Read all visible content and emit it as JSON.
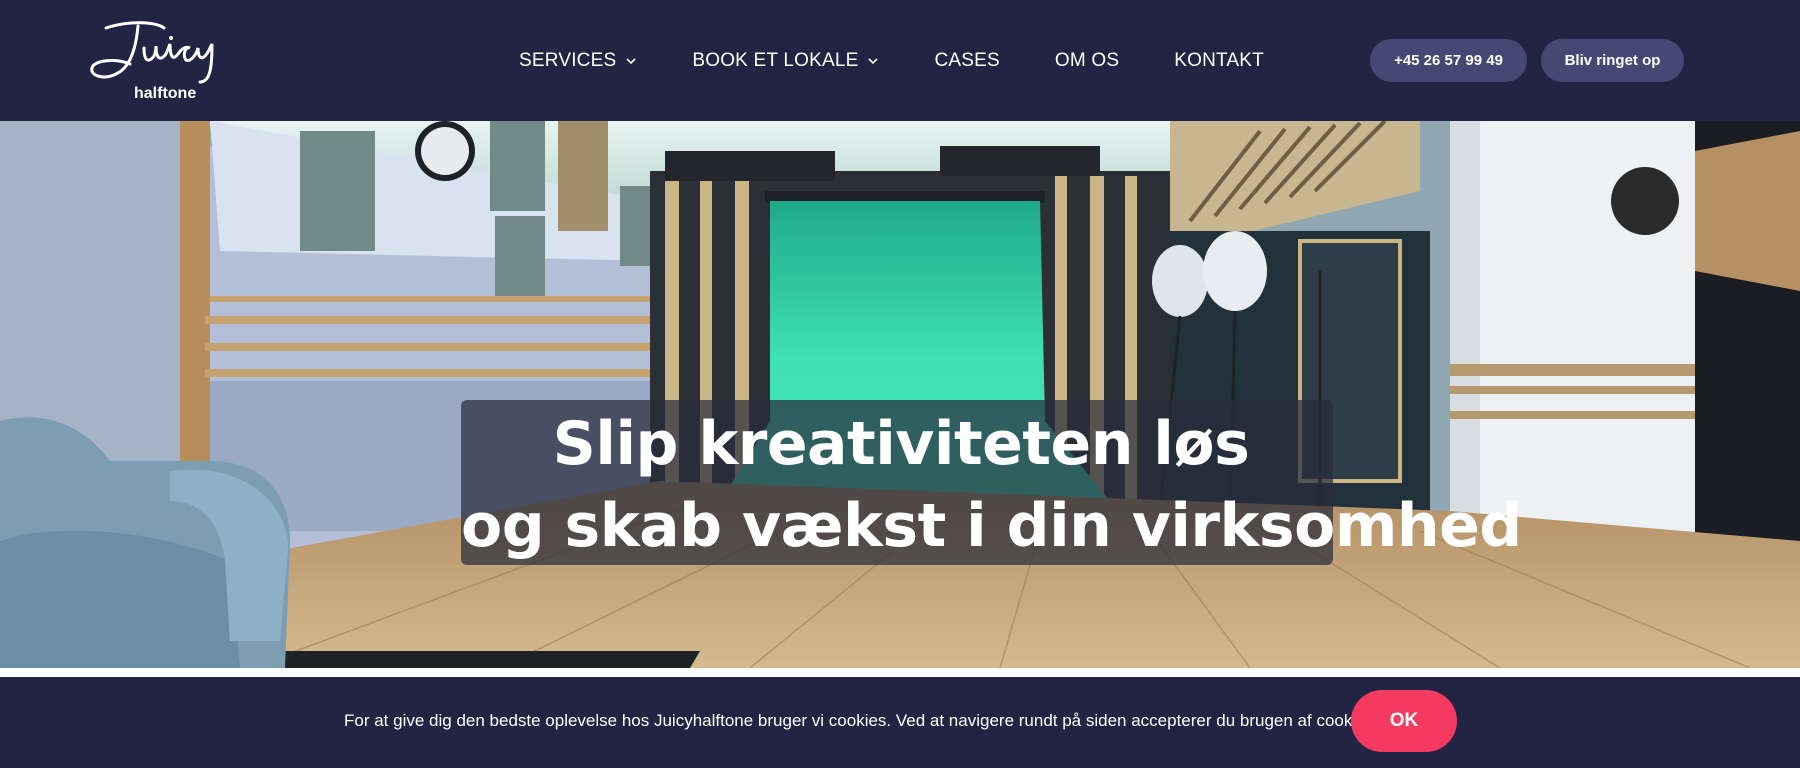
{
  "brand": {
    "name": "Juicy",
    "tagline": "halftone"
  },
  "nav": {
    "items": [
      {
        "label": "SERVICES",
        "has_dropdown": true
      },
      {
        "label": "BOOK ET LOKALE",
        "has_dropdown": true
      },
      {
        "label": "CASES",
        "has_dropdown": false
      },
      {
        "label": "OM OS",
        "has_dropdown": false
      },
      {
        "label": "KONTAKT",
        "has_dropdown": false
      }
    ]
  },
  "header_buttons": {
    "phone_label": "+45 26 57 99 49",
    "callback_label": "Bliv ringet op"
  },
  "hero": {
    "headline_line1": "Slip kreativiteten løs",
    "headline_line2": "og skab vækst i din virksomhed"
  },
  "cookie_banner": {
    "text": "For at give dig den bedste oplevelse hos Juicyhalftone bruger vi cookies. Ved at navigere rundt på siden accepterer du brugen af cookies.",
    "ok_label": "OK"
  },
  "colors": {
    "header_bg": "#222443",
    "button_bg": "#454872",
    "cookie_ok": "#f43a61",
    "backdrop_green": "#3fe0b3"
  },
  "icons": {
    "dropdown": "chevron-down-icon"
  }
}
